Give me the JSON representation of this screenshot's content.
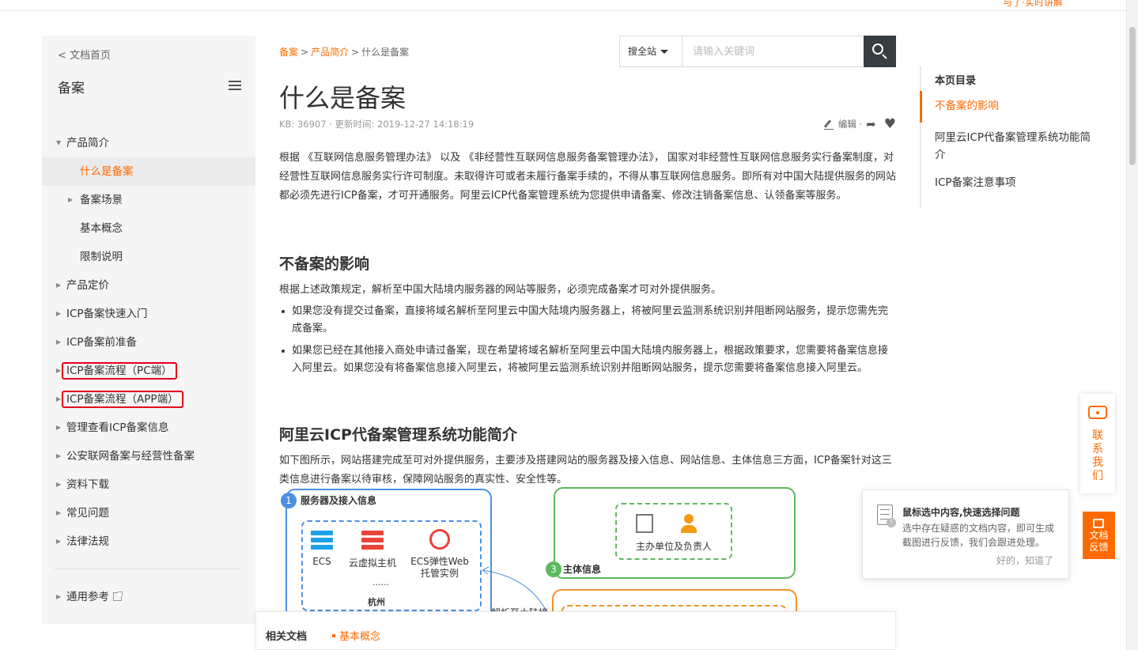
{
  "topbar": {
    "tail_text": "与了·实时讲解"
  },
  "sidebar": {
    "back_label": "< 文档首页",
    "title": "备案",
    "items": [
      {
        "label": "产品简介"
      },
      {
        "label": "什么是备案"
      },
      {
        "label": "备案场景"
      },
      {
        "label": "基本概念"
      },
      {
        "label": "限制说明"
      },
      {
        "label": "产品定价"
      },
      {
        "label": "ICP备案快速入门"
      },
      {
        "label": "ICP备案前准备"
      },
      {
        "label": "ICP备案流程（PC端）"
      },
      {
        "label": "ICP备案流程（APP端）"
      },
      {
        "label": "管理查看ICP备案信息"
      },
      {
        "label": "公安联网备案与经营性备案"
      },
      {
        "label": "资料下载"
      },
      {
        "label": "常见问题"
      },
      {
        "label": "法律法规"
      }
    ],
    "general_ref": "通用参考"
  },
  "breadcrumb": {
    "root": "备案",
    "mid": "产品简介",
    "current": "什么是备案"
  },
  "search": {
    "scope": "搜全站",
    "placeholder": "请输入关键词"
  },
  "article": {
    "title": "什么是备案",
    "meta": "KB: 36907 · 更新时间:   2019-12-27 14:18:19",
    "edit_label": "编辑 ·",
    "intro": "根据 《互联网信息服务管理办法》 以及 《非经营性互联网信息服务备案管理办法》， 国家对非经营性互联网信息服务实行备案制度，对经营性互联网信息服务实行许可制度。未取得许可或者未履行备案手续的，不得从事互联网信息服务。即所有对中国大陆提供服务的网站都必须先进行ICP备案，才可开通服务。阿里云ICP代备案管理系统为您提供申请备案、修改注销备案信息、认领备案等服务。",
    "h2_impact": "不备案的影响",
    "impact_para": "根据上述政策规定，解析至中国大陆境内服务器的网站等服务，必须完成备案才可对外提供服务。",
    "bullets": [
      "如果您没有提交过备案，直接将域名解析至阿里云中国大陆境内服务器上，将被阿里云监测系统识别并阻断网站服务，提示您需先完成备案。",
      "如果您已经在其他接入商处申请过备案，现在希望将域名解析至阿里云中国大陆境内服务器上，根据政策要求，您需要将备案信息接入阿里云。如果您没有将备案信息接入阿里云，将被阿里云监测系统识别并阻断网站服务，提示您需要将备案信息接入阿里云。"
    ],
    "h2_system": "阿里云ICP代备案管理系统功能简介",
    "system_para": "如下图所示，网站搭建完成至可对外提供服务，主要涉及搭建网站的服务器及接入信息、网站信息、主体信息三方面，ICP备案针对这三类信息进行备案以待审核，保障网站服务的真实性、安全性等。"
  },
  "diagram": {
    "box1_num": "1",
    "box1_title": "服务器及接入信息",
    "ecs": "ECS",
    "vm": "云虚拟主机",
    "web_line1": "ECS弹性Web",
    "web_line2": "托管实例",
    "dots": "......",
    "city": "杭州",
    "box3_num": "3",
    "box3_title": "主体信息",
    "entity_label": "主办单位及负责人",
    "resolve": "解析至大陆境"
  },
  "related": {
    "label": "相关文档",
    "link": "基本概念"
  },
  "toc": {
    "title": "本页目录",
    "items": [
      "不备案的影响",
      "阿里云ICP代备案管理系统功能简介",
      "ICP备案注意事项"
    ]
  },
  "float": {
    "contact": "联系我们",
    "feedback": "文档反馈"
  },
  "tip": {
    "title": "鼠标选中内容,快速选择问题",
    "desc": "选中存在疑惑的文档内容，即可生成截图进行反馈，我们会跟进处理。",
    "ok": "好的，知道了"
  },
  "colors": {
    "accent": "#ff6a00",
    "highlight": "#e4001b",
    "search_button": "#373d41"
  }
}
